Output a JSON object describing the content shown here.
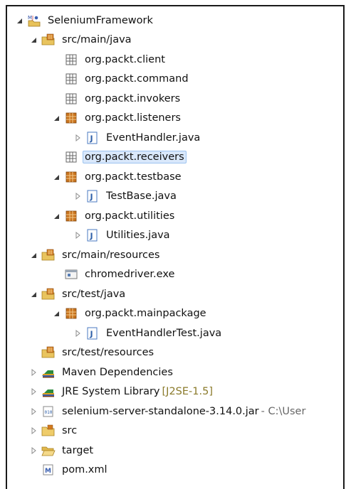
{
  "tree": {
    "items": [
      {
        "label": "SeleniumFramework",
        "level": 0,
        "toggle": "expanded",
        "icon": "maven-project-icon"
      },
      {
        "label": "src/main/java",
        "level": 1,
        "toggle": "expanded",
        "icon": "source-folder-icon"
      },
      {
        "label": "org.packt.client",
        "level": 2,
        "toggle": "none",
        "icon": "empty-package-icon"
      },
      {
        "label": "org.packt.command",
        "level": 2,
        "toggle": "none",
        "icon": "empty-package-icon"
      },
      {
        "label": "org.packt.invokers",
        "level": 2,
        "toggle": "none",
        "icon": "empty-package-icon"
      },
      {
        "label": "org.packt.listeners",
        "level": 2,
        "toggle": "expanded",
        "icon": "package-icon"
      },
      {
        "label": "EventHandler.java",
        "level": 3,
        "toggle": "collapsed",
        "icon": "java-file-icon"
      },
      {
        "label": "org.packt.receivers",
        "level": 2,
        "toggle": "none",
        "icon": "empty-package-icon",
        "selected": true
      },
      {
        "label": "org.packt.testbase",
        "level": 2,
        "toggle": "expanded",
        "icon": "package-icon"
      },
      {
        "label": "TestBase.java",
        "level": 3,
        "toggle": "collapsed",
        "icon": "java-file-icon"
      },
      {
        "label": "org.packt.utilities",
        "level": 2,
        "toggle": "expanded",
        "icon": "package-icon"
      },
      {
        "label": "Utilities.java",
        "level": 3,
        "toggle": "collapsed",
        "icon": "java-file-icon"
      },
      {
        "label": "src/main/resources",
        "level": 1,
        "toggle": "expanded",
        "icon": "source-folder-icon"
      },
      {
        "label": "chromedriver.exe",
        "level": 2,
        "toggle": "none",
        "icon": "exe-file-icon"
      },
      {
        "label": "src/test/java",
        "level": 1,
        "toggle": "expanded",
        "icon": "source-folder-icon"
      },
      {
        "label": "org.packt.mainpackage",
        "level": 2,
        "toggle": "expanded",
        "icon": "package-icon"
      },
      {
        "label": "EventHandlerTest.java",
        "level": 3,
        "toggle": "collapsed",
        "icon": "java-file-icon"
      },
      {
        "label": "src/test/resources",
        "level": 1,
        "toggle": "none",
        "icon": "source-folder-icon"
      },
      {
        "label": "Maven Dependencies",
        "level": 1,
        "toggle": "collapsed",
        "icon": "library-icon"
      },
      {
        "label": "JRE System Library",
        "decoration": "[J2SE-1.5]",
        "level": 1,
        "toggle": "collapsed",
        "icon": "library-icon"
      },
      {
        "label": "selenium-server-standalone-3.14.0.jar",
        "decoration": " - C:\\User",
        "level": 1,
        "toggle": "collapsed",
        "icon": "jar-icon"
      },
      {
        "label": "src",
        "level": 1,
        "toggle": "collapsed",
        "icon": "folder-icon"
      },
      {
        "label": "target",
        "level": 1,
        "toggle": "collapsed",
        "icon": "folder-open-icon"
      },
      {
        "label": "pom.xml",
        "level": 1,
        "toggle": "none",
        "icon": "maven-pom-icon"
      }
    ]
  }
}
